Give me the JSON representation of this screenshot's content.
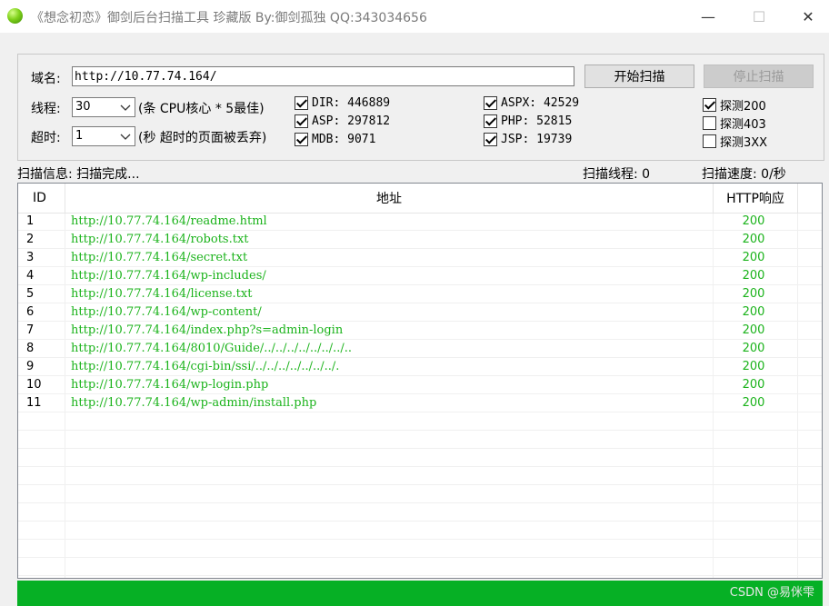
{
  "window": {
    "title": "《想念初恋》御剑后台扫描工具 珍藏版 By:御剑孤独 QQ:343034656",
    "minimize_glyph": "—",
    "maximize_glyph": "☐",
    "close_glyph": "✕"
  },
  "form": {
    "domain_label": "域名:",
    "domain_value": "http://10.77.74.164/",
    "start_button": "开始扫描",
    "stop_button": "停止扫描",
    "threads_label": "线程:",
    "threads_value": "30",
    "threads_hint": "(条 CPU核心 * 5最佳)",
    "timeout_label": "超时:",
    "timeout_value": "1",
    "timeout_hint": "(秒 超时的页面被丢弃)"
  },
  "dictionaries": [
    {
      "label": "DIR: 446889",
      "checked": true
    },
    {
      "label": "ASP: 297812",
      "checked": true
    },
    {
      "label": "MDB: 9071",
      "checked": true
    },
    {
      "label": "ASPX: 42529",
      "checked": true
    },
    {
      "label": "PHP: 52815",
      "checked": true
    },
    {
      "label": "JSP: 19739",
      "checked": true
    }
  ],
  "probes": [
    {
      "label": "探测200",
      "checked": true
    },
    {
      "label": "探测403",
      "checked": false
    },
    {
      "label": "探测3XX",
      "checked": false
    }
  ],
  "status": {
    "info": "扫描信息: 扫描完成...",
    "threads": "扫描线程: 0",
    "speed": "扫描速度: 0/秒"
  },
  "table": {
    "headers": {
      "id": "ID",
      "url": "地址",
      "code": "HTTP响应"
    },
    "rows": [
      {
        "id": "1",
        "url": "http://10.77.74.164/readme.html",
        "code": "200"
      },
      {
        "id": "2",
        "url": "http://10.77.74.164/robots.txt",
        "code": "200"
      },
      {
        "id": "3",
        "url": "http://10.77.74.164/secret.txt",
        "code": "200"
      },
      {
        "id": "4",
        "url": "http://10.77.74.164/wp-includes/",
        "code": "200"
      },
      {
        "id": "5",
        "url": "http://10.77.74.164/license.txt",
        "code": "200"
      },
      {
        "id": "6",
        "url": "http://10.77.74.164/wp-content/",
        "code": "200"
      },
      {
        "id": "7",
        "url": "http://10.77.74.164/index.php?s=admin-login",
        "code": "200"
      },
      {
        "id": "8",
        "url": "http://10.77.74.164/8010/Guide/../../../../../../../..",
        "code": "200"
      },
      {
        "id": "9",
        "url": "http://10.77.74.164/cgi-bin/ssi/../../../../../../../.",
        "code": "200"
      },
      {
        "id": "10",
        "url": "http://10.77.74.164/wp-login.php",
        "code": "200"
      },
      {
        "id": "11",
        "url": "http://10.77.74.164/wp-admin/install.php",
        "code": "200"
      }
    ]
  },
  "progress": {
    "fraction": 1.0
  },
  "watermark": "CSDN @易侎雫",
  "colors": {
    "result_text": "#1bb31b",
    "progress": "#06b025"
  }
}
